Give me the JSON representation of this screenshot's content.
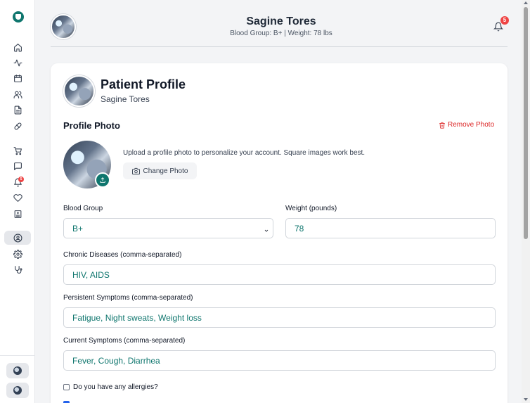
{
  "header": {
    "name": "Sagine Tores",
    "subtitle": "Blood Group: B+ | Weight: 78 lbs",
    "notification_count": "5"
  },
  "sidebar": {
    "items": [
      {
        "icon": "home-icon"
      },
      {
        "icon": "activity-icon"
      },
      {
        "icon": "calendar-icon"
      },
      {
        "icon": "users-icon"
      },
      {
        "icon": "file-text-icon"
      },
      {
        "icon": "pill-icon"
      },
      {
        "icon": "cart-icon"
      },
      {
        "icon": "message-icon"
      },
      {
        "icon": "bell-icon",
        "badge": "5"
      },
      {
        "icon": "heart-icon"
      },
      {
        "icon": "hospital-icon"
      },
      {
        "icon": "user-circle-icon",
        "active": true
      },
      {
        "icon": "settings-icon"
      },
      {
        "icon": "stethoscope-icon"
      }
    ]
  },
  "profile": {
    "title": "Patient Profile",
    "name": "Sagine Tores",
    "photo_section_title": "Profile Photo",
    "remove_photo_label": "Remove Photo",
    "upload_hint": "Upload a profile photo to personalize your account. Square images work best.",
    "change_photo_label": "Change Photo"
  },
  "form": {
    "blood_group_label": "Blood Group",
    "blood_group_value": "B+",
    "weight_label": "Weight (pounds)",
    "weight_value": "78",
    "chronic_label": "Chronic Diseases (comma-separated)",
    "chronic_value": "HIV, AIDS",
    "persistent_label": "Persistent Symptoms (comma-separated)",
    "persistent_value": "Fatigue, Night sweats, Weight loss",
    "current_label": "Current Symptoms (comma-separated)",
    "current_value": "Fever, Cough, Diarrhea",
    "allergies_label": "Do you have any allergies?"
  },
  "colors": {
    "accent": "#0f766e",
    "danger": "#dc2626",
    "badge": "#ef4444"
  }
}
